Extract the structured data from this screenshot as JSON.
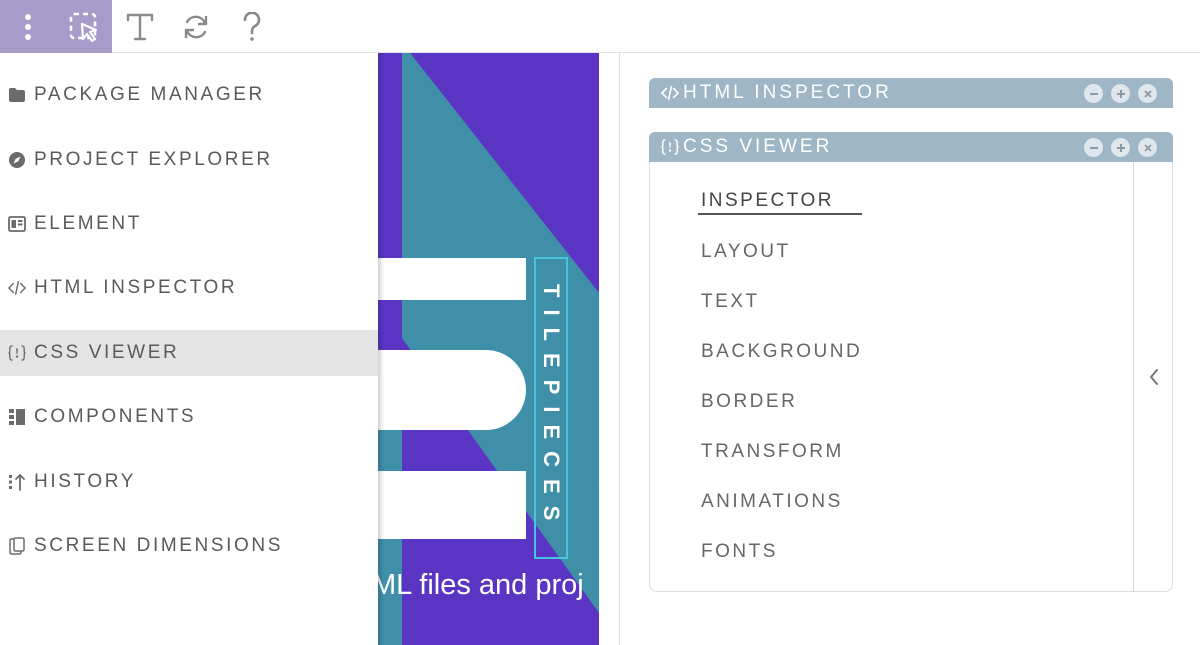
{
  "toolbar": {
    "buttons": [
      {
        "icon": "more-vertical-icon",
        "active": true
      },
      {
        "icon": "select-cursor-icon",
        "active": true
      },
      {
        "icon": "text-tool-icon",
        "active": false
      },
      {
        "icon": "refresh-icon",
        "active": false
      },
      {
        "icon": "help-icon",
        "active": false
      }
    ],
    "active_color": "#a79bc9"
  },
  "menu": {
    "items": [
      {
        "label": "PACKAGE MANAGER",
        "icon": "folder-icon"
      },
      {
        "label": "PROJECT EXPLORER",
        "icon": "compass-icon"
      },
      {
        "label": "ELEMENT",
        "icon": "element-icon"
      },
      {
        "label": "HTML INSPECTOR",
        "icon": "code-icon"
      },
      {
        "label": "CSS VIEWER",
        "icon": "css-icon",
        "active": true
      },
      {
        "label": "COMPONENTS",
        "icon": "components-icon"
      },
      {
        "label": "HISTORY",
        "icon": "history-icon"
      },
      {
        "label": "SCREEN DIMENSIONS",
        "icon": "screen-dimensions-icon"
      }
    ]
  },
  "canvas": {
    "vertical_title": "TILEPIECES",
    "caption": "ML files and proj",
    "colors": {
      "purple": "#5a35c4",
      "teal": "#3f8fa9",
      "white": "#ffffff",
      "outline": "#49c4e0"
    }
  },
  "html_inspector": {
    "title": "HTML INSPECTOR",
    "icon": "code-icon",
    "controls": [
      "minimize-icon",
      "maximize-icon",
      "close-icon"
    ]
  },
  "css_viewer": {
    "title": "CSS VIEWER",
    "icon": "css-icon",
    "controls": [
      "minimize-icon",
      "maximize-icon",
      "close-icon"
    ],
    "items": [
      {
        "label": "INSPECTOR",
        "active": true
      },
      {
        "label": "LAYOUT"
      },
      {
        "label": "TEXT"
      },
      {
        "label": "BACKGROUND"
      },
      {
        "label": "BORDER"
      },
      {
        "label": "TRANSFORM"
      },
      {
        "label": "ANIMATIONS"
      },
      {
        "label": "FONTS"
      }
    ],
    "collapse_icon": "chevron-left-icon"
  },
  "colors": {
    "panel_header": "#9fb6c6",
    "menu_active": "#e4e4e4"
  }
}
